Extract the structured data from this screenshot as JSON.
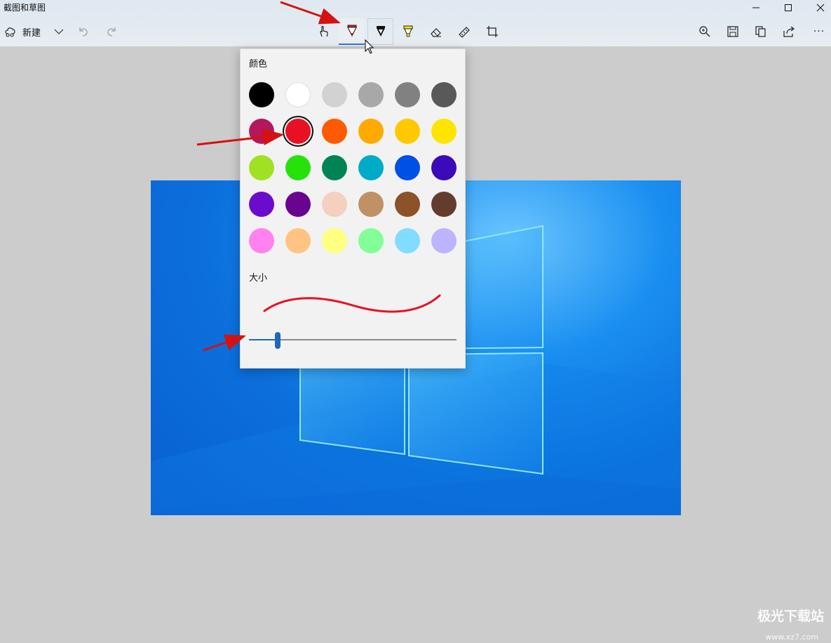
{
  "window": {
    "title": "截图和草图"
  },
  "toolbar": {
    "new_label": "新建",
    "more_label": "···"
  },
  "flyout": {
    "color_label": "颜色",
    "size_label": "大小",
    "selected_color": "#e81123",
    "colors": [
      [
        "#000000",
        "#ffffff",
        "#d2d2d2",
        "#a8a8a8",
        "#818181",
        "#595959"
      ],
      [
        "#b3175c",
        "#e81123",
        "#ff5a00",
        "#ffaa00",
        "#ffc800",
        "#ffe400"
      ],
      [
        "#a0e122",
        "#25e20b",
        "#008454",
        "#00abc8",
        "#0050e6",
        "#3c0ab9"
      ],
      [
        "#6b0ccd",
        "#680490",
        "#f5d0be",
        "#c09164",
        "#8c5228",
        "#643c2d"
      ],
      [
        "#ff82f0",
        "#ffc382",
        "#ffff82",
        "#82ff96",
        "#82dcff",
        "#bcb4ff"
      ]
    ],
    "size_fraction": 0.14
  },
  "watermark": {
    "text": "极光下载站",
    "url": "www.xz7.com"
  }
}
